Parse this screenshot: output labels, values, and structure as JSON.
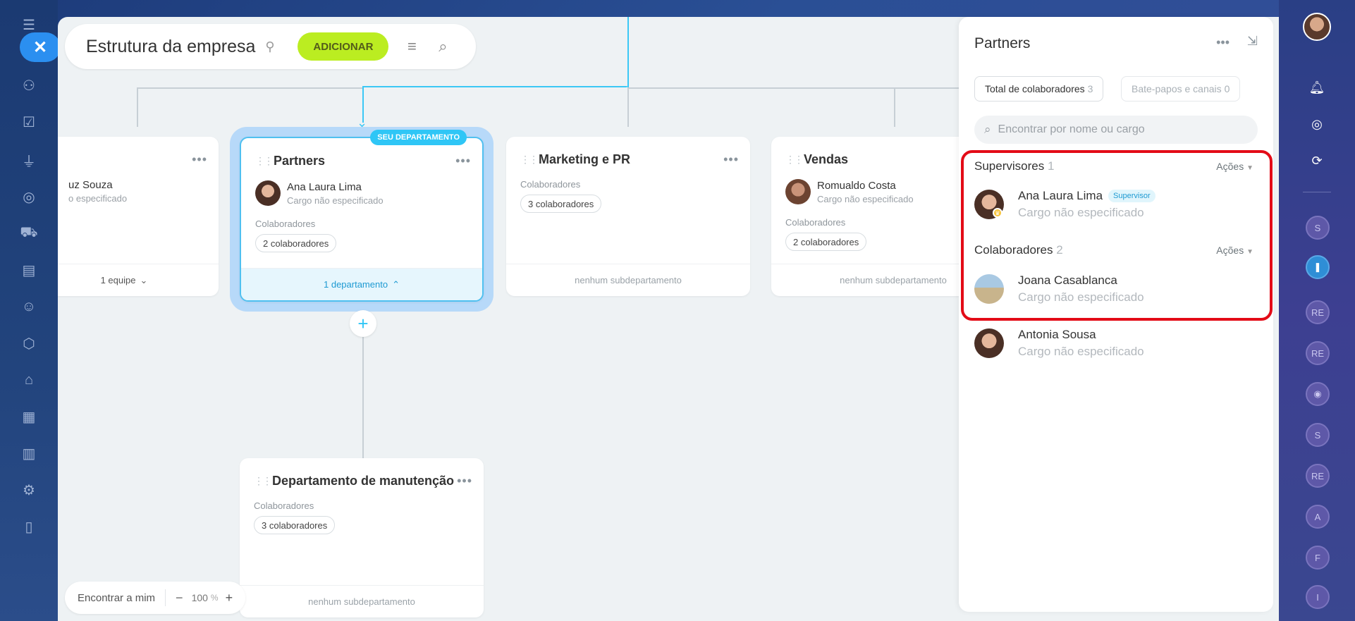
{
  "header": {
    "title": "Estrutura da empresa",
    "add_label": "ADICIONAR"
  },
  "cards": {
    "left_partial": {
      "person_name": "uz Souza",
      "person_role": "o especificado",
      "footer": "1 equipe"
    },
    "partners": {
      "name": "Partners",
      "badge": "SEU DEPARTAMENTO",
      "person_name": "Ana Laura Lima",
      "person_role": "Cargo não especificado",
      "collab_label": "Colaboradores",
      "collab_count": "2 colaboradores",
      "footer": "1 departamento"
    },
    "marketing": {
      "name": "Marketing e PR",
      "collab_label": "Colaboradores",
      "collab_count": "3 colaboradores",
      "footer": "nenhum subdepartamento"
    },
    "vendas": {
      "name": "Vendas",
      "person_name": "Romualdo Costa",
      "person_role": "Cargo não especificado",
      "collab_label": "Colaboradores",
      "collab_count": "2 colaboradores",
      "footer": "nenhum subdepartamento"
    },
    "manutencao": {
      "name": "Departamento de manutenção",
      "collab_label": "Colaboradores",
      "collab_count": "3 colaboradores",
      "footer": "nenhum subdepartamento"
    }
  },
  "bottom": {
    "find_me": "Encontrar a mim",
    "zoom": "100",
    "zoom_unit": "%"
  },
  "panel": {
    "title": "Partners",
    "tabs": [
      {
        "label": "Total de colaboradores",
        "count": "3"
      },
      {
        "label": "Bate-papos e canais",
        "count": "0"
      }
    ],
    "search_placeholder": "Encontrar por nome ou cargo",
    "supervisors": {
      "title": "Supervisores",
      "count": "1",
      "actions": "Ações",
      "people": [
        {
          "name": "Ana Laura Lima",
          "badge": "Supervisor",
          "role": "Cargo não especificado"
        }
      ]
    },
    "collaborators": {
      "title": "Colaboradores",
      "count": "2",
      "actions": "Ações",
      "people": [
        {
          "name": "Joana Casablanca",
          "role": "Cargo não especificado"
        },
        {
          "name": "Antonia Sousa",
          "role": "Cargo não especificado"
        }
      ]
    }
  },
  "right_bar": {
    "chips": [
      "S",
      "RE",
      "RE",
      "S",
      "RE",
      "A",
      "F",
      "I"
    ]
  },
  "colors": {
    "accent": "#2fc6f6",
    "add_button": "#bbed21",
    "highlight_box": "#e30b17"
  }
}
